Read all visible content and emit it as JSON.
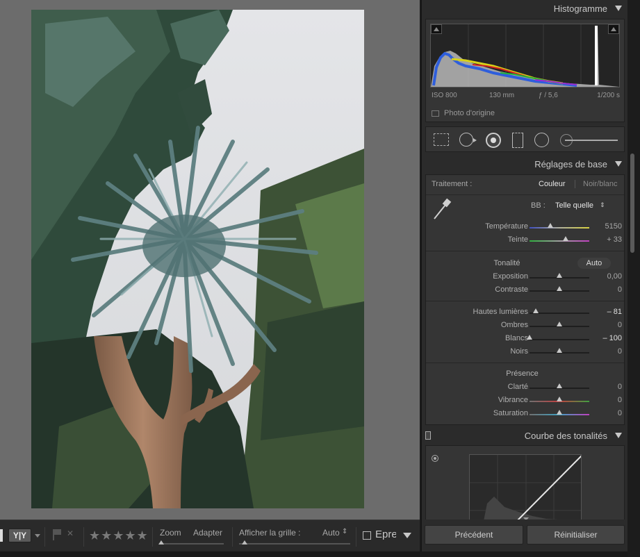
{
  "histogram": {
    "title": "Histogramme",
    "iso": "ISO 800",
    "focal": "130 mm",
    "aperture": "ƒ / 5,6",
    "shutter": "1/200 s",
    "original_photo": "Photo d'origine"
  },
  "tools": [
    "crop-overlay-icon",
    "spot-removal-icon",
    "red-eye-icon",
    "graduated-filter-icon",
    "radial-filter-icon",
    "adjustment-brush-icon"
  ],
  "basic": {
    "title": "Réglages de base",
    "treatment_label": "Traitement :",
    "color_option": "Couleur",
    "bw_option": "Noir/blanc",
    "wb_label": "BB :",
    "wb_value": "Telle quelle",
    "wb_arrows": "⇕",
    "tone_label": "Tonalité",
    "auto_label": "Auto",
    "presence_label": "Présence",
    "sliders": {
      "temperature": {
        "label": "Température",
        "value": "5150",
        "position": 0.35
      },
      "tint": {
        "label": "Teinte",
        "value": "+ 33",
        "position": 0.6
      },
      "exposure": {
        "label": "Exposition",
        "value": "0,00",
        "position": 0.5
      },
      "contrast": {
        "label": "Contraste",
        "value": "0",
        "position": 0.5
      },
      "highlights": {
        "label": "Hautes lumières",
        "value": "– 81",
        "position": 0.1
      },
      "shadows": {
        "label": "Ombres",
        "value": "0",
        "position": 0.5
      },
      "whites": {
        "label": "Blancs",
        "value": "– 100",
        "position": 0.0
      },
      "blacks": {
        "label": "Noirs",
        "value": "0",
        "position": 0.5
      },
      "clarity": {
        "label": "Clarté",
        "value": "0",
        "position": 0.5
      },
      "vibrance": {
        "label": "Vibrance",
        "value": "0",
        "position": 0.5
      },
      "saturation": {
        "label": "Saturation",
        "value": "0",
        "position": 0.5
      }
    }
  },
  "tone_curve": {
    "title": "Courbe des tonalités"
  },
  "buttons": {
    "previous": "Précédent",
    "reset": "Réinitialiser"
  },
  "toolbar": {
    "compare_label": "Y|Y",
    "zoom_label": "Zoom",
    "zoom_value": "Adapter",
    "grid_label": "Afficher la grille :",
    "grid_value": "Auto",
    "grid_arrows": "⇕",
    "stars": "★★★★★",
    "proof_label": "Epre"
  },
  "colors": {
    "accent": "#c8c8c8",
    "panel": "#353535",
    "background": "#2b2b2b"
  }
}
